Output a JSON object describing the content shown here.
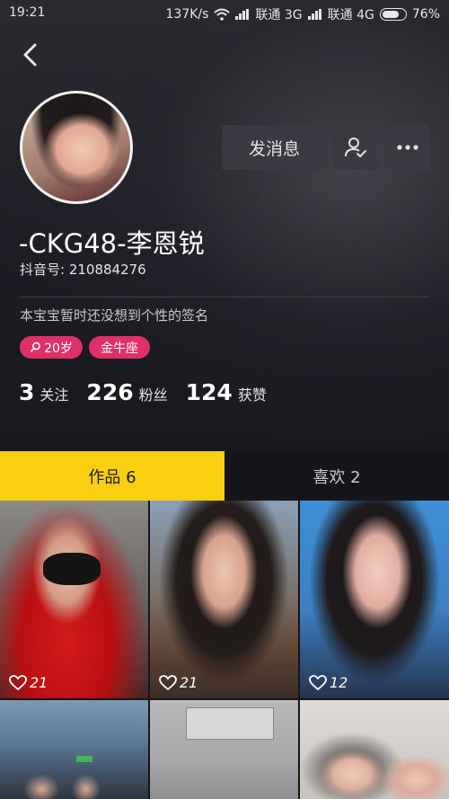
{
  "status_bar": {
    "time": "19:21",
    "speed": "137K/s",
    "carrier1": "联通 3G",
    "carrier2": "联通 4G",
    "battery": "76%"
  },
  "profile": {
    "name": "-CKG48-李恩锐",
    "douyin_id": "抖音号: 210884276",
    "signature": "本宝宝暂时还没想到个性的签名",
    "tags": [
      "20岁",
      "金牛座"
    ],
    "stats": [
      {
        "value": "3",
        "label": "关注"
      },
      {
        "value": "226",
        "label": "粉丝"
      },
      {
        "value": "124",
        "label": "获赞"
      }
    ]
  },
  "actions": {
    "message_label": "发消息",
    "follow_icon": "user-check-icon",
    "more_icon": "more-dots-icon"
  },
  "tabs": [
    {
      "label": "作品 6",
      "active": true
    },
    {
      "label": "喜欢 2",
      "active": false
    }
  ],
  "videos": [
    {
      "likes": "21"
    },
    {
      "likes": "21"
    },
    {
      "likes": "12"
    },
    {
      "likes": ""
    },
    {
      "likes": ""
    },
    {
      "likes": ""
    }
  ],
  "colors": {
    "accent_yellow": "#f9cf0f",
    "tag_pink": "#e0306a",
    "background": "#15161c"
  }
}
